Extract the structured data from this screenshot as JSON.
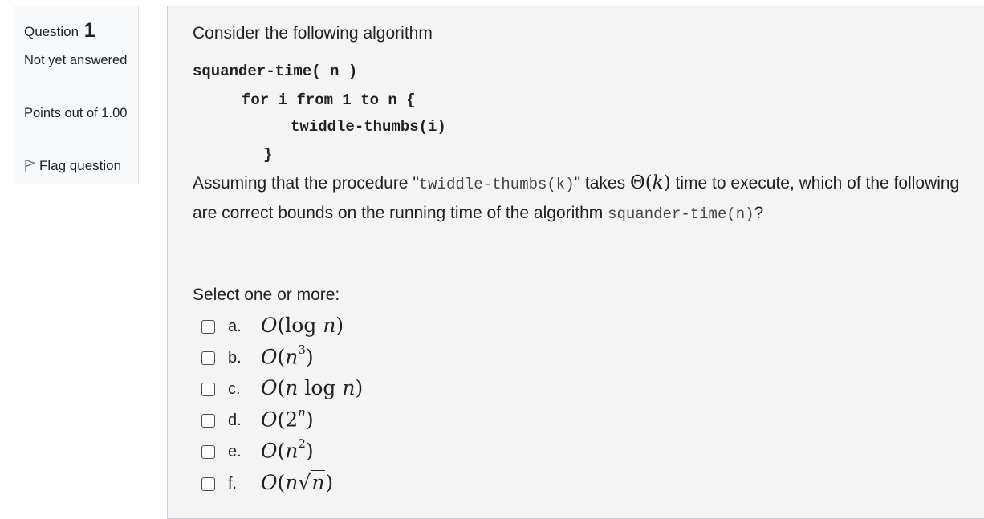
{
  "info": {
    "question_label": "Question",
    "question_number": "1",
    "state": "Not yet answered",
    "grade": "Points out of 1.00",
    "flag_label": "Flag question"
  },
  "question": {
    "intro": "Consider the following algorithm",
    "code_lines": [
      "squander-time( n )",
      "for i from 1 to n {",
      "twiddle-thumbs(i)",
      "}"
    ],
    "assume_part1": "Assuming that the procedure \"",
    "assume_code1": "twiddle-thumbs(k)",
    "assume_part2": "\" takes ",
    "assume_theta": "Θ(",
    "assume_k": "k",
    "assume_close": ")",
    "assume_part3": " time to execute, which of the following are correct bounds on the running time of the algorithm ",
    "assume_code2": "squander-time(n)",
    "assume_part4": "?",
    "select_prompt": "Select one or more:"
  },
  "options": [
    {
      "letter": "a.",
      "expr": "O(log n)",
      "checked": false
    },
    {
      "letter": "b.",
      "expr": "O(n³)",
      "checked": false
    },
    {
      "letter": "c.",
      "expr": "O(n log n)",
      "checked": false
    },
    {
      "letter": "d.",
      "expr": "O(2ⁿ)",
      "checked": false
    },
    {
      "letter": "e.",
      "expr": "O(n²)",
      "checked": false
    },
    {
      "letter": "f.",
      "expr": "O(n√n)",
      "checked": false
    }
  ]
}
